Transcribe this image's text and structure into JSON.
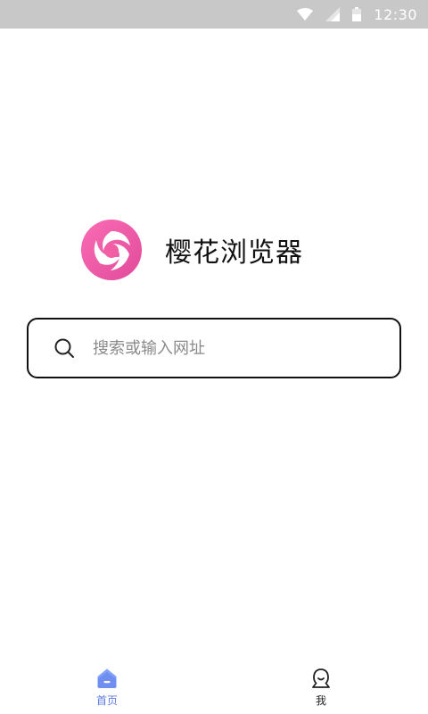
{
  "status_bar": {
    "time": "12:30",
    "icons": [
      "wifi-icon",
      "cell-signal-icon",
      "battery-icon"
    ]
  },
  "brand": {
    "app_name": "樱花浏览器",
    "logo_icon": "sakura-swirl-logo",
    "logo_colors": [
      "#f85aa6",
      "#f25f9a",
      "#d84b97"
    ]
  },
  "search": {
    "placeholder": "搜索或输入网址",
    "value": "",
    "icon": "search-icon"
  },
  "bottom_nav": {
    "items": [
      {
        "label": "首页",
        "icon": "home-icon",
        "active": true
      },
      {
        "label": "我",
        "icon": "user-icon",
        "active": false
      }
    ],
    "active_color": "#5c7ce0"
  }
}
